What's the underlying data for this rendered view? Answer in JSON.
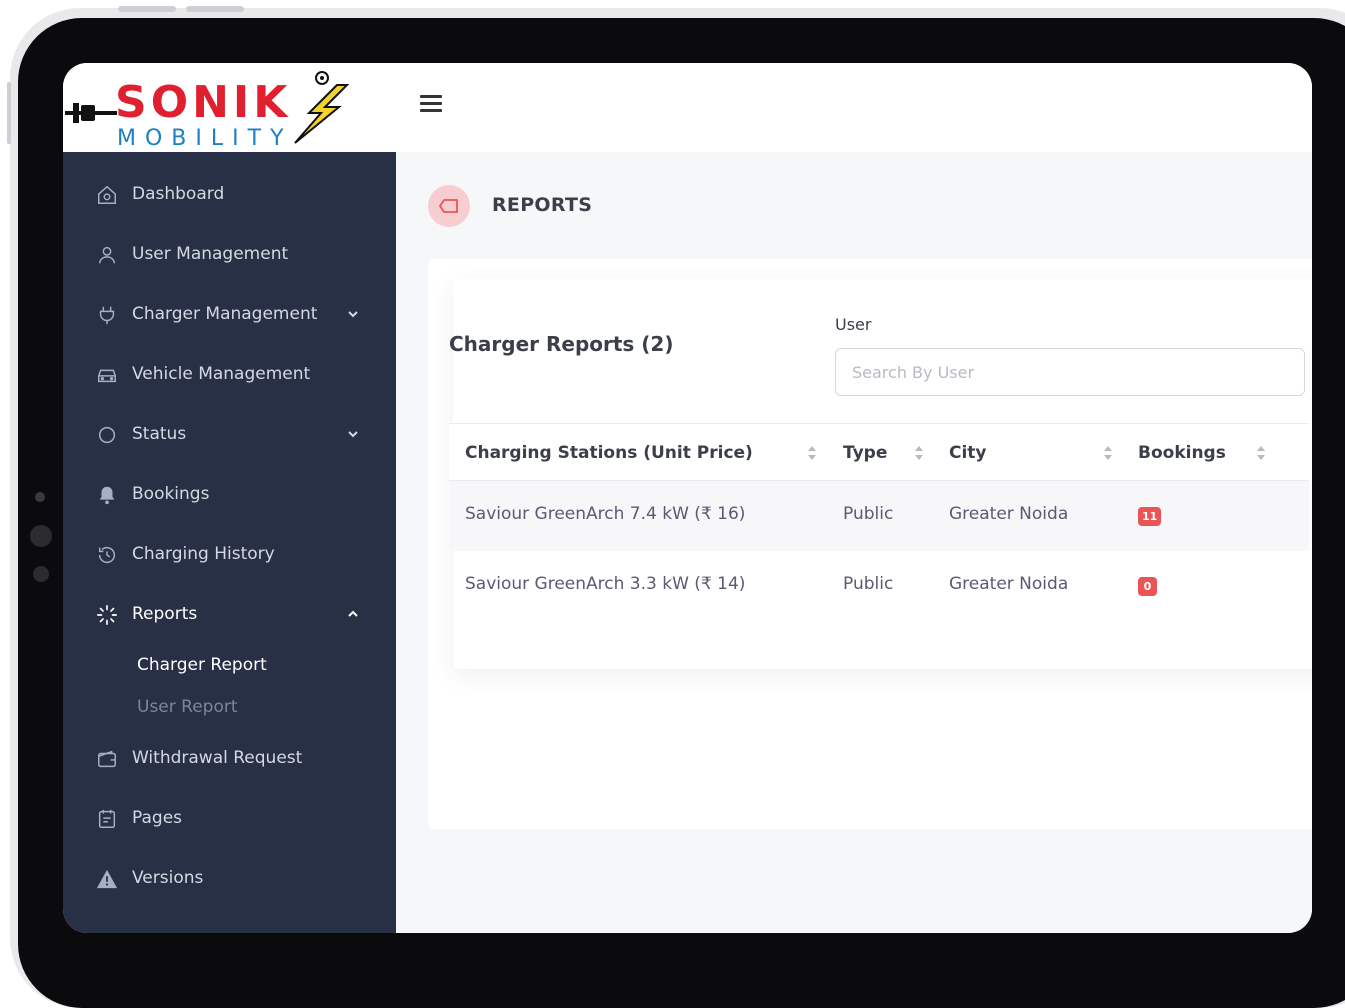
{
  "logo": {
    "brand": "SONIK",
    "sub": "MOBILITY"
  },
  "sidebar": {
    "items": [
      {
        "label": "Dashboard",
        "icon": "home-icon"
      },
      {
        "label": "User Management",
        "icon": "user-icon"
      },
      {
        "label": "Charger Management",
        "icon": "plug-icon"
      },
      {
        "label": "Vehicle Management",
        "icon": "car-icon"
      },
      {
        "label": "Status",
        "icon": "circle-icon"
      },
      {
        "label": "Bookings",
        "icon": "bell-icon"
      },
      {
        "label": "Charging History",
        "icon": "history-icon"
      },
      {
        "label": "Reports",
        "icon": "loader-icon"
      },
      {
        "label": "Withdrawal Request",
        "icon": "wallet-icon"
      },
      {
        "label": "Pages",
        "icon": "file-icon"
      },
      {
        "label": "Versions",
        "icon": "alert-triangle-icon"
      }
    ],
    "sub_items": [
      {
        "label": "Charger Report"
      },
      {
        "label": "User Report"
      }
    ]
  },
  "page": {
    "title": "REPORTS"
  },
  "report": {
    "title": "Charger Reports (2)",
    "filter_label": "User",
    "search_placeholder": "Search By User"
  },
  "table": {
    "columns": [
      "Charging Stations (Unit Price)",
      "Type",
      "City",
      "Bookings"
    ],
    "rows": [
      {
        "station": "Saviour GreenArch 7.4 kW (₹ 16)",
        "type": "Public",
        "city": "Greater Noida",
        "bookings": "11"
      },
      {
        "station": "Saviour GreenArch 3.3 kW (₹ 14)",
        "type": "Public",
        "city": "Greater Noida",
        "bookings": "0"
      }
    ]
  },
  "colors": {
    "sidebar_bg": "#283046",
    "accent_red": "#ea5455",
    "logo_red": "#e0202e",
    "logo_blue": "#1d7fc4",
    "logo_yellow": "#f3d22a"
  }
}
